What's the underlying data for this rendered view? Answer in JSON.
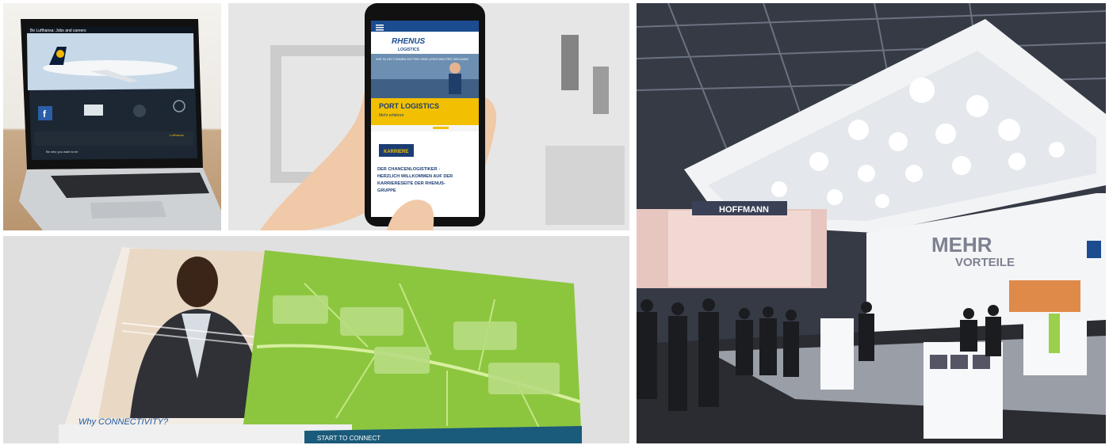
{
  "laptop": {
    "screen_title": "Be Lufthansa: Jobs and careers",
    "footer_text": "Be who you want to be",
    "brand": "Lufthansa"
  },
  "phone": {
    "brand_line1": "RHENUS",
    "brand_line2": "LOGISTICS",
    "hero_caption": "WIE IN 130 TONNEN KETTEN SIND LEISTUNG PRO SEKUNDE",
    "headline": "PORT LOGISTICS",
    "more_link": "Mehr erfahren",
    "button_label": "KARRIERE",
    "body_line1": "DER CHANCENLOGISTIKER -",
    "body_line2": "HERZLICH WILLKOMMEN AUF DER",
    "body_line3": "KARRIERESEITE DER RHENUS-",
    "body_line4": "GRUPPE"
  },
  "brochure": {
    "left_caption": "Why CONNECTIVITY?",
    "bottom_bar": "START TO CONNECT"
  },
  "booth": {
    "sign_line1": "MEHR",
    "sign_line2": "VORTEILE",
    "top_sign": "HOFFMANN"
  },
  "colors": {
    "rhenus_yellow": "#f2c000",
    "rhenus_blue": "#1b4c8f",
    "leaf_green": "#8cc63f",
    "lufthansa_navy": "#0a1d3a",
    "booth_white": "#f2f3f5"
  }
}
